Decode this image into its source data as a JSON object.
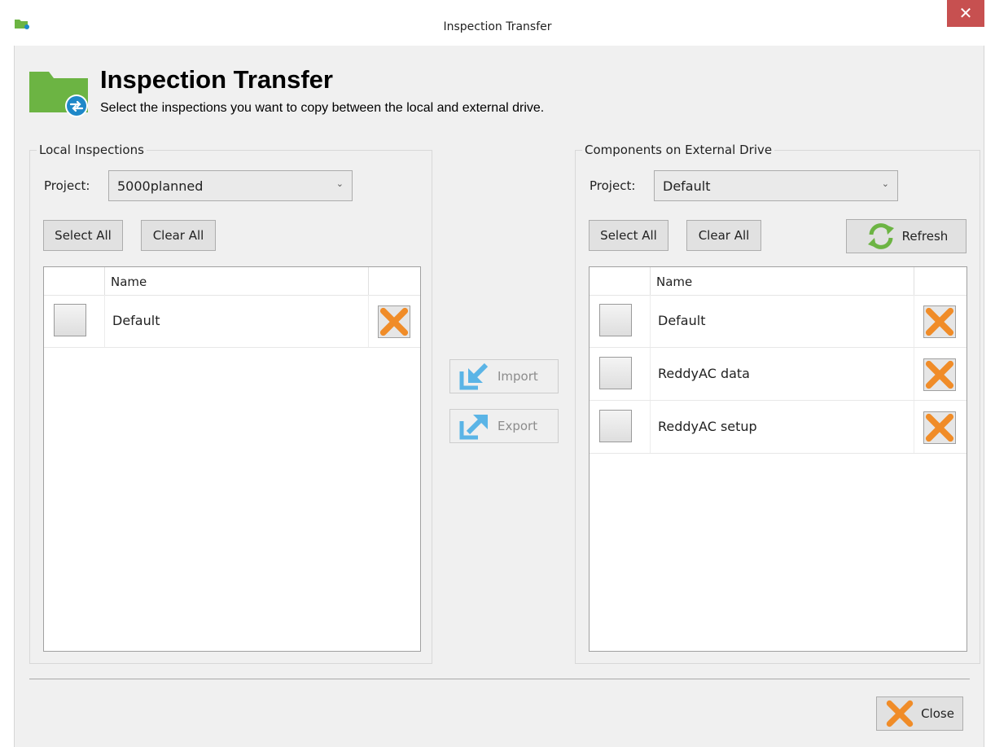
{
  "window": {
    "title": "Inspection Transfer",
    "close_glyph": "✕"
  },
  "header": {
    "title": "Inspection Transfer",
    "subtitle": "Select the inspections you want to copy between the local and external drive.",
    "icon": "folder-transfer-icon"
  },
  "local": {
    "group_label": "Local Inspections",
    "project_label": "Project:",
    "project_value": "5000planned",
    "select_all": "Select All",
    "clear_all": "Clear All",
    "column_name": "Name",
    "rows": [
      {
        "name": "Default",
        "checked": false
      }
    ]
  },
  "transfer": {
    "import_label": "Import",
    "export_label": "Export"
  },
  "external": {
    "group_label": "Components on External Drive",
    "project_label": "Project:",
    "project_value": "Default",
    "select_all": "Select All",
    "clear_all": "Clear All",
    "refresh": "Refresh",
    "column_name": "Name",
    "rows": [
      {
        "name": "Default",
        "checked": false
      },
      {
        "name": "ReddyAC data",
        "checked": false
      },
      {
        "name": "ReddyAC setup",
        "checked": false
      }
    ]
  },
  "footer": {
    "close_label": "Close"
  },
  "colors": {
    "accent_orange": "#f08c28",
    "folder_green": "#6cb443",
    "transfer_blue": "#5ab4e6",
    "close_red": "#c75050"
  }
}
